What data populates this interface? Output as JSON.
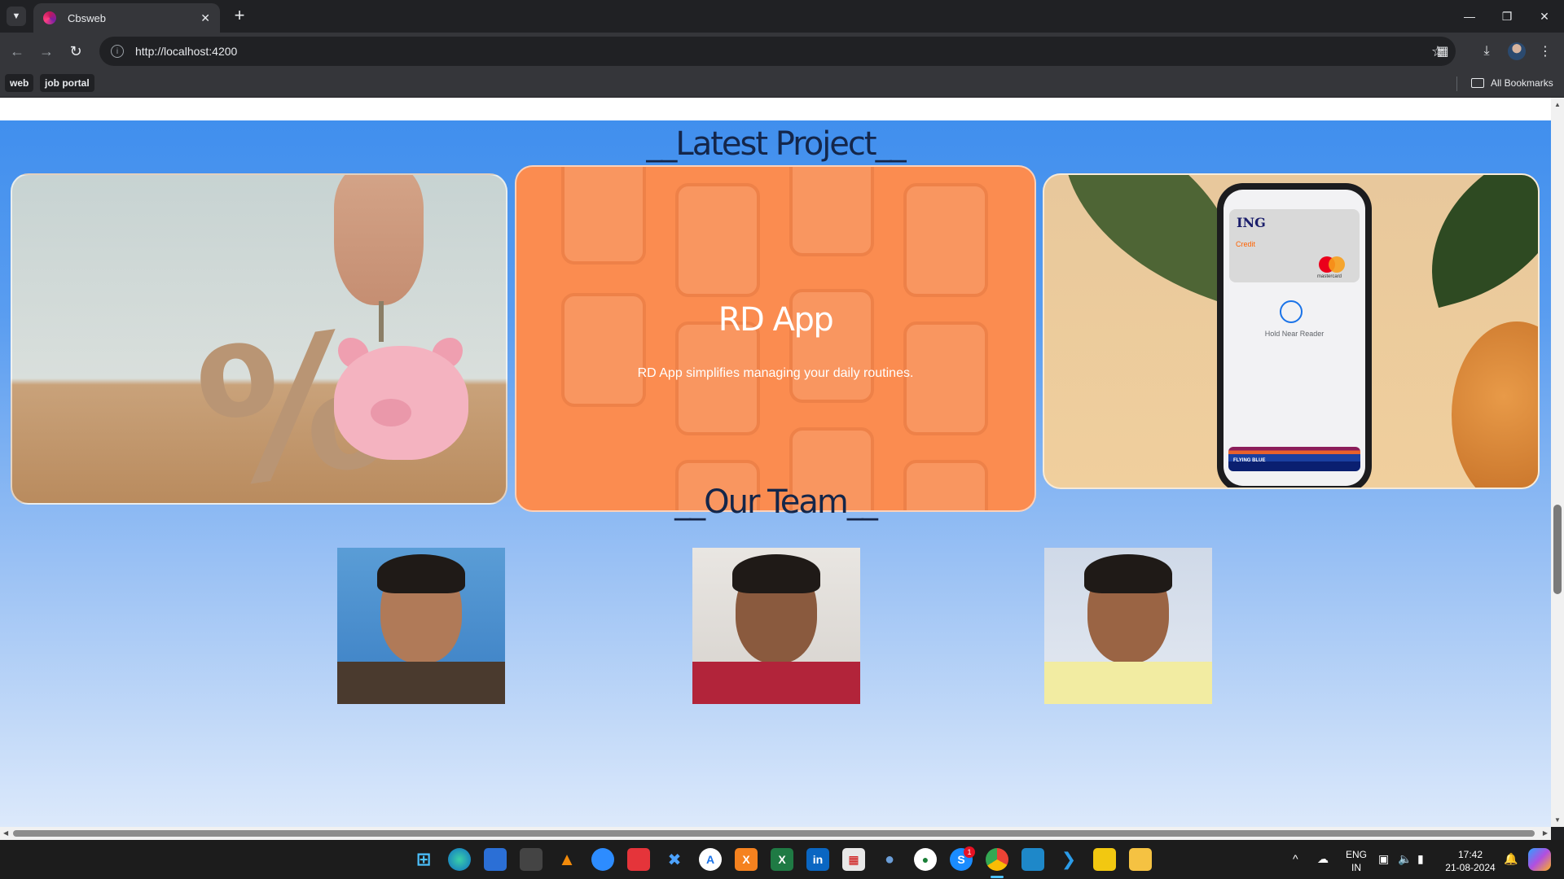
{
  "browser": {
    "tab_title": "Cbsweb",
    "url": "http://localhost:4200",
    "bookmarks": [
      "web",
      "job portal"
    ],
    "all_bookmarks_label": "All Bookmarks"
  },
  "page": {
    "projects_title": "__Latest Project__",
    "featured_project": {
      "title": "RD App",
      "description": "RD App simplifies managing your daily routines."
    },
    "card3_phone": {
      "brand": "ING",
      "card_type": "Credit",
      "network": "mastercard",
      "prompt": "Hold Near Reader",
      "stack_label": "FLYING BLUE"
    },
    "team_title": "__Our Team__"
  },
  "taskbar": {
    "language": "ENG",
    "region": "IN",
    "time": "17:42",
    "date": "21-08-2024",
    "skype_badge": "1"
  }
}
